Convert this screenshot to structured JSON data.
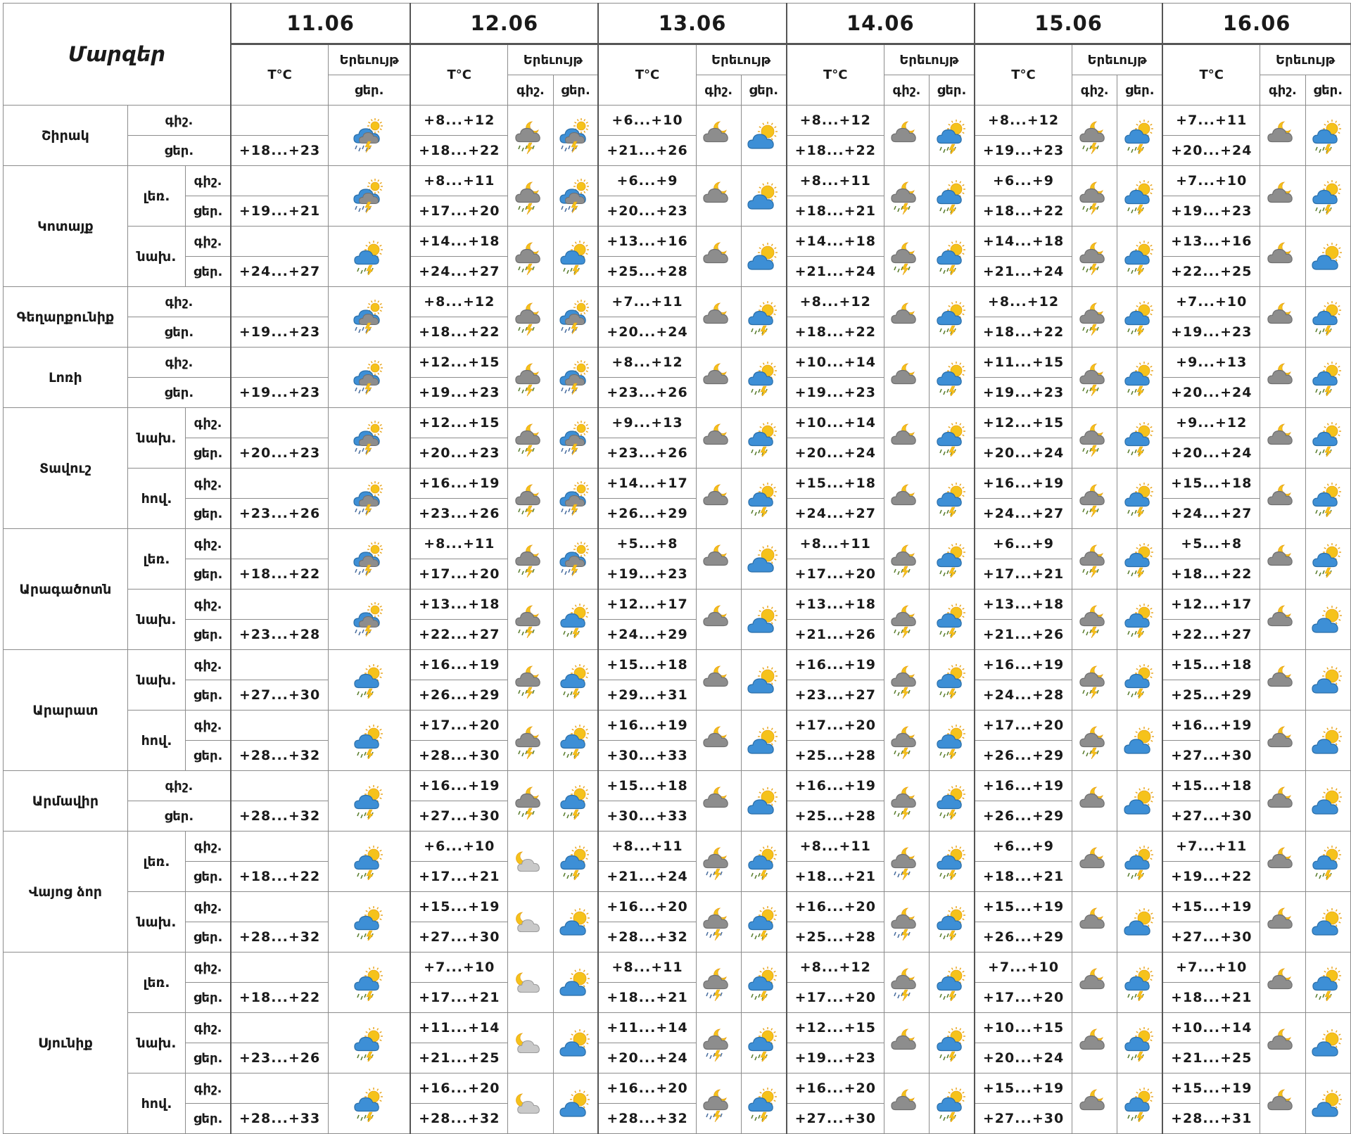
{
  "header": {
    "marzer": "Մարզեր",
    "tc": "T°C",
    "erevuyt": "Երեւույթ",
    "night": "գիշ.",
    "day": "ցեր.",
    "dates": [
      "11.06",
      "12.06",
      "13.06",
      "14.06",
      "15.06",
      "16.06"
    ]
  },
  "regions": [
    {
      "name": "Շիրակ",
      "subs": [
        {
          "label": "",
          "days": [
            {
              "n": "",
              "d": "+18...+23",
              "icn": "",
              "icd": "rain-thunder"
            },
            {
              "n": "+8...+12",
              "d": "+18...+22",
              "icn": "night-cloud-thunder",
              "icd": "rain-thunder"
            },
            {
              "n": "+6...+10",
              "d": "+21...+26",
              "icn": "night-cloud",
              "icd": "sun-cloud"
            },
            {
              "n": "+8...+12",
              "d": "+18...+22",
              "icn": "night-cloud",
              "icd": "sun-cloud-rain"
            },
            {
              "n": "+8...+12",
              "d": "+19...+23",
              "icn": "night-cloud-thunder",
              "icd": "sun-cloud-rain"
            },
            {
              "n": "+7...+11",
              "d": "+20...+24",
              "icn": "night-cloud",
              "icd": "sun-cloud-rain"
            }
          ]
        }
      ]
    },
    {
      "name": "Կոտայք",
      "subs": [
        {
          "label": "լեռ.",
          "days": [
            {
              "n": "",
              "d": "+19...+21",
              "icn": "",
              "icd": "rain-thunder"
            },
            {
              "n": "+8...+11",
              "d": "+17...+20",
              "icn": "night-cloud-thunder",
              "icd": "rain-thunder"
            },
            {
              "n": "+6...+9",
              "d": "+20...+23",
              "icn": "night-cloud",
              "icd": "sun-cloud"
            },
            {
              "n": "+8...+11",
              "d": "+18...+21",
              "icn": "night-cloud-thunder",
              "icd": "sun-cloud-rain"
            },
            {
              "n": "+6...+9",
              "d": "+18...+22",
              "icn": "night-cloud-thunder",
              "icd": "sun-cloud-rain"
            },
            {
              "n": "+7...+10",
              "d": "+19...+23",
              "icn": "night-cloud",
              "icd": "sun-cloud-rain"
            }
          ]
        },
        {
          "label": "նախ.",
          "days": [
            {
              "n": "",
              "d": "+24...+27",
              "icn": "",
              "icd": "sun-cloud-rain"
            },
            {
              "n": "+14...+18",
              "d": "+24...+27",
              "icn": "night-cloud-thunder",
              "icd": "sun-cloud-rain"
            },
            {
              "n": "+13...+16",
              "d": "+25...+28",
              "icn": "night-cloud",
              "icd": "sun-cloud"
            },
            {
              "n": "+14...+18",
              "d": "+21...+24",
              "icn": "night-cloud-thunder",
              "icd": "sun-cloud-rain"
            },
            {
              "n": "+14...+18",
              "d": "+21...+24",
              "icn": "night-cloud-thunder",
              "icd": "sun-cloud-rain"
            },
            {
              "n": "+13...+16",
              "d": "+22...+25",
              "icn": "night-cloud",
              "icd": "sun-cloud"
            }
          ]
        }
      ]
    },
    {
      "name": "Գեղարքունիք",
      "subs": [
        {
          "label": "",
          "days": [
            {
              "n": "",
              "d": "+19...+23",
              "icn": "",
              "icd": "rain-thunder"
            },
            {
              "n": "+8...+12",
              "d": "+18...+22",
              "icn": "night-cloud-thunder",
              "icd": "rain-thunder"
            },
            {
              "n": "+7...+11",
              "d": "+20...+24",
              "icn": "night-cloud",
              "icd": "sun-cloud-rain"
            },
            {
              "n": "+8...+12",
              "d": "+18...+22",
              "icn": "night-cloud",
              "icd": "sun-cloud-rain"
            },
            {
              "n": "+8...+12",
              "d": "+18...+22",
              "icn": "night-cloud-thunder",
              "icd": "sun-cloud-rain"
            },
            {
              "n": "+7...+10",
              "d": "+19...+23",
              "icn": "night-cloud",
              "icd": "sun-cloud-rain"
            }
          ]
        }
      ]
    },
    {
      "name": "Լոռի",
      "subs": [
        {
          "label": "",
          "days": [
            {
              "n": "",
              "d": "+19...+23",
              "icn": "",
              "icd": "rain-thunder"
            },
            {
              "n": "+12...+15",
              "d": "+19...+23",
              "icn": "night-cloud-thunder",
              "icd": "rain-thunder"
            },
            {
              "n": "+8...+12",
              "d": "+23...+26",
              "icn": "night-cloud",
              "icd": "sun-cloud-rain"
            },
            {
              "n": "+10...+14",
              "d": "+19...+23",
              "icn": "night-cloud",
              "icd": "sun-cloud-rain"
            },
            {
              "n": "+11...+15",
              "d": "+19...+23",
              "icn": "night-cloud-thunder",
              "icd": "sun-cloud-rain"
            },
            {
              "n": "+9...+13",
              "d": "+20...+24",
              "icn": "night-cloud",
              "icd": "sun-cloud-rain"
            }
          ]
        }
      ]
    },
    {
      "name": "Տավուշ",
      "subs": [
        {
          "label": "նախ.",
          "days": [
            {
              "n": "",
              "d": "+20...+23",
              "icn": "",
              "icd": "rain-thunder"
            },
            {
              "n": "+12...+15",
              "d": "+20...+23",
              "icn": "night-cloud-thunder",
              "icd": "rain-thunder"
            },
            {
              "n": "+9...+13",
              "d": "+23...+26",
              "icn": "night-cloud",
              "icd": "sun-cloud-rain"
            },
            {
              "n": "+10...+14",
              "d": "+20...+24",
              "icn": "night-cloud",
              "icd": "sun-cloud-rain"
            },
            {
              "n": "+12...+15",
              "d": "+20...+24",
              "icn": "night-cloud-thunder",
              "icd": "sun-cloud-rain"
            },
            {
              "n": "+9...+12",
              "d": "+20...+24",
              "icn": "night-cloud",
              "icd": "sun-cloud-rain"
            }
          ]
        },
        {
          "label": "հով.",
          "days": [
            {
              "n": "",
              "d": "+23...+26",
              "icn": "",
              "icd": "rain-thunder"
            },
            {
              "n": "+16...+19",
              "d": "+23...+26",
              "icn": "night-cloud-thunder",
              "icd": "rain-thunder"
            },
            {
              "n": "+14...+17",
              "d": "+26...+29",
              "icn": "night-cloud",
              "icd": "sun-cloud-rain"
            },
            {
              "n": "+15...+18",
              "d": "+24...+27",
              "icn": "night-cloud",
              "icd": "sun-cloud-rain"
            },
            {
              "n": "+16...+19",
              "d": "+24...+27",
              "icn": "night-cloud-thunder",
              "icd": "sun-cloud-rain"
            },
            {
              "n": "+15...+18",
              "d": "+24...+27",
              "icn": "night-cloud",
              "icd": "sun-cloud-rain"
            }
          ]
        }
      ]
    },
    {
      "name": "Արագածոտն",
      "subs": [
        {
          "label": "լեռ.",
          "days": [
            {
              "n": "",
              "d": "+18...+22",
              "icn": "",
              "icd": "rain-thunder"
            },
            {
              "n": "+8...+11",
              "d": "+17...+20",
              "icn": "night-cloud-thunder",
              "icd": "rain-thunder"
            },
            {
              "n": "+5...+8",
              "d": "+19...+23",
              "icn": "night-cloud",
              "icd": "sun-cloud"
            },
            {
              "n": "+8...+11",
              "d": "+17...+20",
              "icn": "night-cloud-thunder",
              "icd": "sun-cloud-rain"
            },
            {
              "n": "+6...+9",
              "d": "+17...+21",
              "icn": "night-cloud-thunder",
              "icd": "sun-cloud-rain"
            },
            {
              "n": "+5...+8",
              "d": "+18...+22",
              "icn": "night-cloud",
              "icd": "sun-cloud-rain"
            }
          ]
        },
        {
          "label": "նախ.",
          "days": [
            {
              "n": "",
              "d": "+23...+28",
              "icn": "",
              "icd": "rain-thunder"
            },
            {
              "n": "+13...+18",
              "d": "+22...+27",
              "icn": "night-cloud-thunder",
              "icd": "sun-cloud-rain"
            },
            {
              "n": "+12...+17",
              "d": "+24...+29",
              "icn": "night-cloud",
              "icd": "sun-cloud"
            },
            {
              "n": "+13...+18",
              "d": "+21...+26",
              "icn": "night-cloud-thunder",
              "icd": "sun-cloud-rain"
            },
            {
              "n": "+13...+18",
              "d": "+21...+26",
              "icn": "night-cloud-thunder",
              "icd": "sun-cloud-rain"
            },
            {
              "n": "+12...+17",
              "d": "+22...+27",
              "icn": "night-cloud",
              "icd": "sun-cloud"
            }
          ]
        }
      ]
    },
    {
      "name": "Արարատ",
      "subs": [
        {
          "label": "նախ.",
          "days": [
            {
              "n": "",
              "d": "+27...+30",
              "icn": "",
              "icd": "sun-cloud-rain"
            },
            {
              "n": "+16...+19",
              "d": "+26...+29",
              "icn": "night-cloud-thunder",
              "icd": "sun-cloud-rain"
            },
            {
              "n": "+15...+18",
              "d": "+29...+31",
              "icn": "night-cloud",
              "icd": "sun-cloud"
            },
            {
              "n": "+16...+19",
              "d": "+23...+27",
              "icn": "night-cloud-thunder",
              "icd": "sun-cloud-rain"
            },
            {
              "n": "+16...+19",
              "d": "+24...+28",
              "icn": "night-cloud-thunder",
              "icd": "sun-cloud-rain"
            },
            {
              "n": "+15...+18",
              "d": "+25...+29",
              "icn": "night-cloud",
              "icd": "sun-cloud"
            }
          ]
        },
        {
          "label": "հով.",
          "days": [
            {
              "n": "",
              "d": "+28...+32",
              "icn": "",
              "icd": "sun-cloud-rain"
            },
            {
              "n": "+17...+20",
              "d": "+28...+30",
              "icn": "night-cloud-thunder",
              "icd": "sun-cloud-rain"
            },
            {
              "n": "+16...+19",
              "d": "+30...+33",
              "icn": "night-cloud",
              "icd": "sun-cloud"
            },
            {
              "n": "+17...+20",
              "d": "+25...+28",
              "icn": "night-cloud-thunder",
              "icd": "sun-cloud-rain"
            },
            {
              "n": "+17...+20",
              "d": "+26...+29",
              "icn": "night-cloud-thunder",
              "icd": "sun-cloud"
            },
            {
              "n": "+16...+19",
              "d": "+27...+30",
              "icn": "night-cloud",
              "icd": "sun-cloud"
            }
          ]
        }
      ]
    },
    {
      "name": "Արմավիր",
      "subs": [
        {
          "label": "",
          "days": [
            {
              "n": "",
              "d": "+28...+32",
              "icn": "",
              "icd": "sun-cloud-rain"
            },
            {
              "n": "+16...+19",
              "d": "+27...+30",
              "icn": "night-cloud-thunder",
              "icd": "sun-cloud-rain"
            },
            {
              "n": "+15...+18",
              "d": "+30...+33",
              "icn": "night-cloud",
              "icd": "sun-cloud"
            },
            {
              "n": "+16...+19",
              "d": "+25...+28",
              "icn": "night-cloud-thunder",
              "icd": "sun-cloud-rain"
            },
            {
              "n": "+16...+19",
              "d": "+26...+29",
              "icn": "night-cloud",
              "icd": "sun-cloud"
            },
            {
              "n": "+15...+18",
              "d": "+27...+30",
              "icn": "night-cloud",
              "icd": "sun-cloud"
            }
          ]
        }
      ]
    },
    {
      "name": "Վայոց ձոր",
      "subs": [
        {
          "label": "լեռ.",
          "days": [
            {
              "n": "",
              "d": "+18...+22",
              "icn": "",
              "icd": "sun-cloud-rain"
            },
            {
              "n": "+6...+10",
              "d": "+17...+21",
              "icn": "moon-cloud-light",
              "icd": "sun-cloud-rain"
            },
            {
              "n": "+8...+11",
              "d": "+21...+24",
              "icn": "night-cloud-rain",
              "icd": "sun-cloud-rain"
            },
            {
              "n": "+8...+11",
              "d": "+18...+21",
              "icn": "night-cloud-rain",
              "icd": "sun-cloud-rain"
            },
            {
              "n": "+6...+9",
              "d": "+18...+21",
              "icn": "night-cloud",
              "icd": "sun-cloud-rain"
            },
            {
              "n": "+7...+11",
              "d": "+19...+22",
              "icn": "night-cloud",
              "icd": "sun-cloud-rain"
            }
          ]
        },
        {
          "label": "նախ.",
          "days": [
            {
              "n": "",
              "d": "+28...+32",
              "icn": "",
              "icd": "sun-cloud-rain"
            },
            {
              "n": "+15...+19",
              "d": "+27...+30",
              "icn": "moon-cloud-light",
              "icd": "sun-cloud"
            },
            {
              "n": "+16...+20",
              "d": "+28...+32",
              "icn": "night-cloud-rain",
              "icd": "sun-cloud-rain"
            },
            {
              "n": "+16...+20",
              "d": "+25...+28",
              "icn": "night-cloud-rain",
              "icd": "sun-cloud-rain"
            },
            {
              "n": "+15...+19",
              "d": "+26...+29",
              "icn": "night-cloud",
              "icd": "sun-cloud"
            },
            {
              "n": "+15...+19",
              "d": "+27...+30",
              "icn": "night-cloud",
              "icd": "sun-cloud"
            }
          ]
        }
      ]
    },
    {
      "name": "Սյունիք",
      "subs": [
        {
          "label": "լեռ.",
          "days": [
            {
              "n": "",
              "d": "+18...+22",
              "icn": "",
              "icd": "sun-cloud-rain"
            },
            {
              "n": "+7...+10",
              "d": "+17...+21",
              "icn": "moon-cloud-light",
              "icd": "sun-cloud"
            },
            {
              "n": "+8...+11",
              "d": "+18...+21",
              "icn": "night-cloud-rain",
              "icd": "sun-cloud-rain"
            },
            {
              "n": "+8...+12",
              "d": "+17...+20",
              "icn": "night-cloud-rain",
              "icd": "sun-cloud-rain"
            },
            {
              "n": "+7...+10",
              "d": "+17...+20",
              "icn": "night-cloud",
              "icd": "sun-cloud-rain"
            },
            {
              "n": "+7...+10",
              "d": "+18...+21",
              "icn": "night-cloud",
              "icd": "sun-cloud-rain"
            }
          ]
        },
        {
          "label": "նախ.",
          "days": [
            {
              "n": "",
              "d": "+23...+26",
              "icn": "",
              "icd": "sun-cloud-rain"
            },
            {
              "n": "+11...+14",
              "d": "+21...+25",
              "icn": "moon-cloud-light",
              "icd": "sun-cloud"
            },
            {
              "n": "+11...+14",
              "d": "+20...+24",
              "icn": "night-cloud-rain",
              "icd": "sun-cloud-rain"
            },
            {
              "n": "+12...+15",
              "d": "+19...+23",
              "icn": "night-cloud",
              "icd": "sun-cloud-rain"
            },
            {
              "n": "+10...+15",
              "d": "+20...+24",
              "icn": "night-cloud",
              "icd": "sun-cloud-rain"
            },
            {
              "n": "+10...+14",
              "d": "+21...+25",
              "icn": "night-cloud",
              "icd": "sun-cloud"
            }
          ]
        },
        {
          "label": "հով.",
          "days": [
            {
              "n": "",
              "d": "+28...+33",
              "icn": "",
              "icd": "sun-cloud-rain"
            },
            {
              "n": "+16...+20",
              "d": "+28...+32",
              "icn": "moon-cloud-light",
              "icd": "sun-cloud"
            },
            {
              "n": "+16...+20",
              "d": "+28...+32",
              "icn": "night-cloud-rain",
              "icd": "sun-cloud-rain"
            },
            {
              "n": "+16...+20",
              "d": "+27...+30",
              "icn": "night-cloud",
              "icd": "sun-cloud-rain"
            },
            {
              "n": "+15...+19",
              "d": "+27...+30",
              "icn": "night-cloud",
              "icd": "sun-cloud-rain"
            },
            {
              "n": "+15...+19",
              "d": "+28...+31",
              "icn": "night-cloud",
              "icd": "sun-cloud"
            }
          ]
        }
      ]
    }
  ]
}
